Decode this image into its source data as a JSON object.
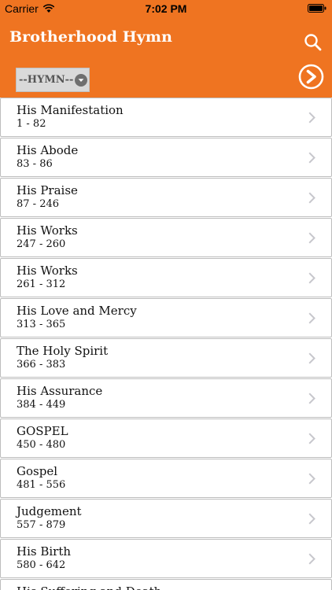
{
  "status_bar": {
    "carrier": "Carrier",
    "time": "7:02 PM"
  },
  "header": {
    "title": "Brotherhood Hymn",
    "background_color": "#ef7421",
    "search_icon": "search-icon",
    "go_icon": "arrow-right-circle-icon"
  },
  "hymn_select": {
    "selected": "--HYMN--"
  },
  "hymn_list": [
    {
      "title": "His Manifestation",
      "range": "1 - 82"
    },
    {
      "title": "His Abode",
      "range": "83 - 86"
    },
    {
      "title": "His Praise",
      "range": "87 - 246"
    },
    {
      "title": "His Works",
      "range": "247 - 260"
    },
    {
      "title": "His Works",
      "range": "261 - 312"
    },
    {
      "title": "His Love and Mercy",
      "range": "313 - 365"
    },
    {
      "title": "The Holy Spirit",
      "range": "366 - 383"
    },
    {
      "title": "His Assurance",
      "range": "384 - 449"
    },
    {
      "title": "GOSPEL",
      "range": "450 - 480"
    },
    {
      "title": "Gospel",
      "range": "481 - 556"
    },
    {
      "title": "Judgement",
      "range": "557 - 879"
    },
    {
      "title": "His Birth",
      "range": "580 - 642"
    },
    {
      "title": "His Suffering and Death",
      "range": ""
    }
  ]
}
